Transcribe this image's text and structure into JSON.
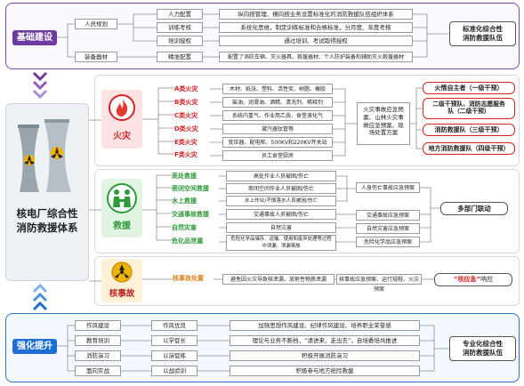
{
  "core_title": "核电厂综合性消防救援体系",
  "core_line1": "核电厂综合性",
  "core_line2": "消防救援体系",
  "top": {
    "head": "基础建设",
    "result": "标准化综合性消防救援队伍",
    "result_l1": "标准化综合性",
    "result_l2": "消防救援队伍",
    "cats": [
      "人员规划",
      "装备器材"
    ],
    "subs": [
      "人力配置",
      "训练考核",
      "培训授权",
      "精准配置"
    ],
    "descs": [
      "纵向按管理、横向按业务设置标准化的消防救援队伍组织体系",
      "系统化思维，制定训练标准和合格标准，分月度、年度考核",
      "通过培训、考试取得授权",
      "配置了消防车辆、灭火器具、救援器材、个人防护装备和辅助灭火救援器材"
    ]
  },
  "fire": {
    "label": "火灾",
    "classes": [
      "A类火灾",
      "B类火灾",
      "C类火灾",
      "D类火灾",
      "E类火灾",
      "F类火灾"
    ],
    "descs": [
      "木材、纸张、塑料、活性炭、树脂、橡胶",
      "柴油、润滑油、酒精、清洗剂、稀释剂",
      "系统内氢气、作业用乙炔、食堂液化气",
      "凝汽器钛管等",
      "变压器、配电柜、500KV和220KV开关站",
      "员工食堂厨房"
    ],
    "plan": "火灾事故应急预案、山林火灾事故应急预案、现场处置方案",
    "plan_lines": [
      "火灾事故应急预",
      "案、山林火灾事",
      "故应急预案、现",
      "场处置方案"
    ],
    "levels": [
      "火情自主者（一级干预）",
      "二级干预队、消防志愿服务队（二级干预）",
      "消防救援队（三级干预）",
      "地方消防救援队（四级干预）"
    ],
    "level2_lines": [
      "二级干预队、消防志愿服务",
      "队（二级干预）"
    ]
  },
  "rescue": {
    "label": "救援",
    "types": [
      "高处救援",
      "密闭空间救援",
      "水上救援",
      "交通事故救援",
      "自然灾害",
      "危化品泄漏"
    ],
    "descs": [
      "高处作业人员被困/伤亡",
      "密闭空间作业人员被困/伤亡",
      "水上作业/不慎落水人员被困/伤亡",
      "交通事故人员被困/伤亡",
      "自然灾害",
      "危险化学品储存、运输、使用和废弃处理等过程中泄漏、泄漏事故"
    ],
    "desc6_lines": [
      "危险化学品储存、运输、使用和废弃处理等过程",
      "中泄漏、泄漏事故"
    ],
    "plans": [
      "人身伤亡事故应急预案",
      "交通事故应急预案",
      "自然灾害应急预案",
      "危险化学品应急预案"
    ],
    "result": "多部门联动"
  },
  "nuclear": {
    "label": "核事故",
    "type": "核事故处置",
    "desc": "避免因火灾导致核泄漏、放射性物质泄漏",
    "plan": "核事故应急预案、运行规程、火灾预案",
    "result_quote": "“核应急”",
    "result_tail": "响应"
  },
  "bottom": {
    "head": "强化提升",
    "result": "专业化综合性消防救援队伍",
    "result_l1": "专业化综合性",
    "result_l2": "消防救援队伍",
    "cats": [
      "作风建设",
      "教育培训",
      "消防演习",
      "面向实战"
    ],
    "subs": [
      "作风优良",
      "以学促长",
      "以演促练",
      "以战验训"
    ],
    "descs": [
      "加强思想作风建设、纪律作风建设、培养职业荣誉感",
      "理论与业务不断档，“请进来、走出去”，自培委培共推进",
      "积极开展消防演习",
      "积极参与地方抢险救援"
    ]
  },
  "colors": {
    "purple": "#6d3aa0",
    "blue": "#1f6fd3",
    "red": "#d42424",
    "green": "#2f9a3c",
    "orange": "#e0821c"
  }
}
